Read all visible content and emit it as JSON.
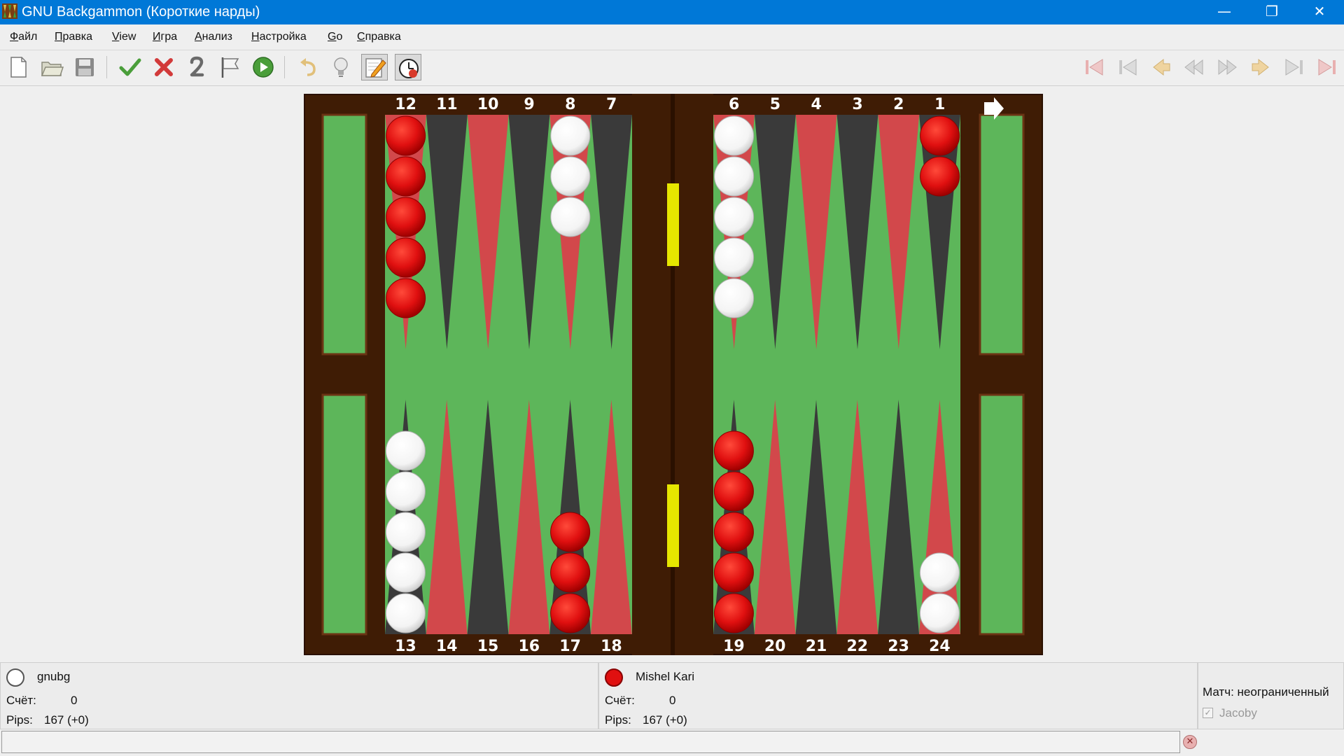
{
  "window": {
    "title": "GNU Backgammon (Короткие нарды)",
    "minimize_glyph": "—",
    "restore_glyph": "❐",
    "close_glyph": "✕"
  },
  "menu": [
    {
      "underline": "Ф",
      "rest": "айл"
    },
    {
      "underline": "П",
      "rest": "равка"
    },
    {
      "underline": "V",
      "rest": "iew"
    },
    {
      "underline": "И",
      "rest": "гра"
    },
    {
      "underline": "А",
      "rest": "нализ"
    },
    {
      "underline": "Н",
      "rest": "астройка"
    },
    {
      "underline": "G",
      "rest": "o"
    },
    {
      "underline": "С",
      "rest": "правка"
    }
  ],
  "toolbar": {
    "left": [
      "new-icon",
      "open-icon",
      "save-icon",
      "accept-icon",
      "reject-icon",
      "double-icon",
      "resign-flag-icon",
      "play-icon",
      "undo-icon",
      "hint-icon",
      "edit-icon",
      "clock-icon"
    ],
    "right": [
      "first-game-icon",
      "previous-game-icon",
      "previous-move-icon",
      "previous-roll-icon",
      "next-roll-icon",
      "next-move-icon",
      "next-game-icon",
      "end-icon"
    ],
    "pressed": [
      "edit-icon"
    ]
  },
  "board": {
    "top_labels_left": [
      "12",
      "11",
      "10",
      "9",
      "8",
      "7"
    ],
    "top_labels_right": [
      "6",
      "5",
      "4",
      "3",
      "2",
      "1"
    ],
    "bottom_labels_left": [
      "13",
      "14",
      "15",
      "16",
      "17",
      "18"
    ],
    "bottom_labels_right": [
      "19",
      "20",
      "21",
      "22",
      "23",
      "24"
    ],
    "points": {
      "1": {
        "color": "red",
        "count": 2
      },
      "6": {
        "color": "white",
        "count": 5
      },
      "8": {
        "color": "white",
        "count": 3
      },
      "12": {
        "color": "red",
        "count": 5
      },
      "13": {
        "color": "white",
        "count": 5
      },
      "17": {
        "color": "red",
        "count": 3
      },
      "19": {
        "color": "red",
        "count": 5
      },
      "24": {
        "color": "white",
        "count": 2
      }
    },
    "direction_arrow": "right-arrow-icon",
    "colors": {
      "frame": "#3f1c05",
      "felt": "#5db65a",
      "point_red": "#d2484b",
      "point_dark": "#3a3a3a",
      "checker_red": "#e01010",
      "checker_white": "#ffffff",
      "cube_yellow": "#e6e600"
    }
  },
  "player1": {
    "name": "gnubg",
    "score_label": "Счёт:",
    "score": "0",
    "pips_label": "Pips:",
    "pips": "167 (+0)",
    "color": "white"
  },
  "player2": {
    "name": "Mishel Kari",
    "score_label": "Счёт:",
    "score": "0",
    "pips_label": "Pips:",
    "pips": "167 (+0)",
    "color": "red"
  },
  "match": {
    "label": "Матч: неограниченный",
    "jacoby_label": "Jacoby",
    "jacoby_checked": true
  },
  "status": {
    "text": ""
  }
}
